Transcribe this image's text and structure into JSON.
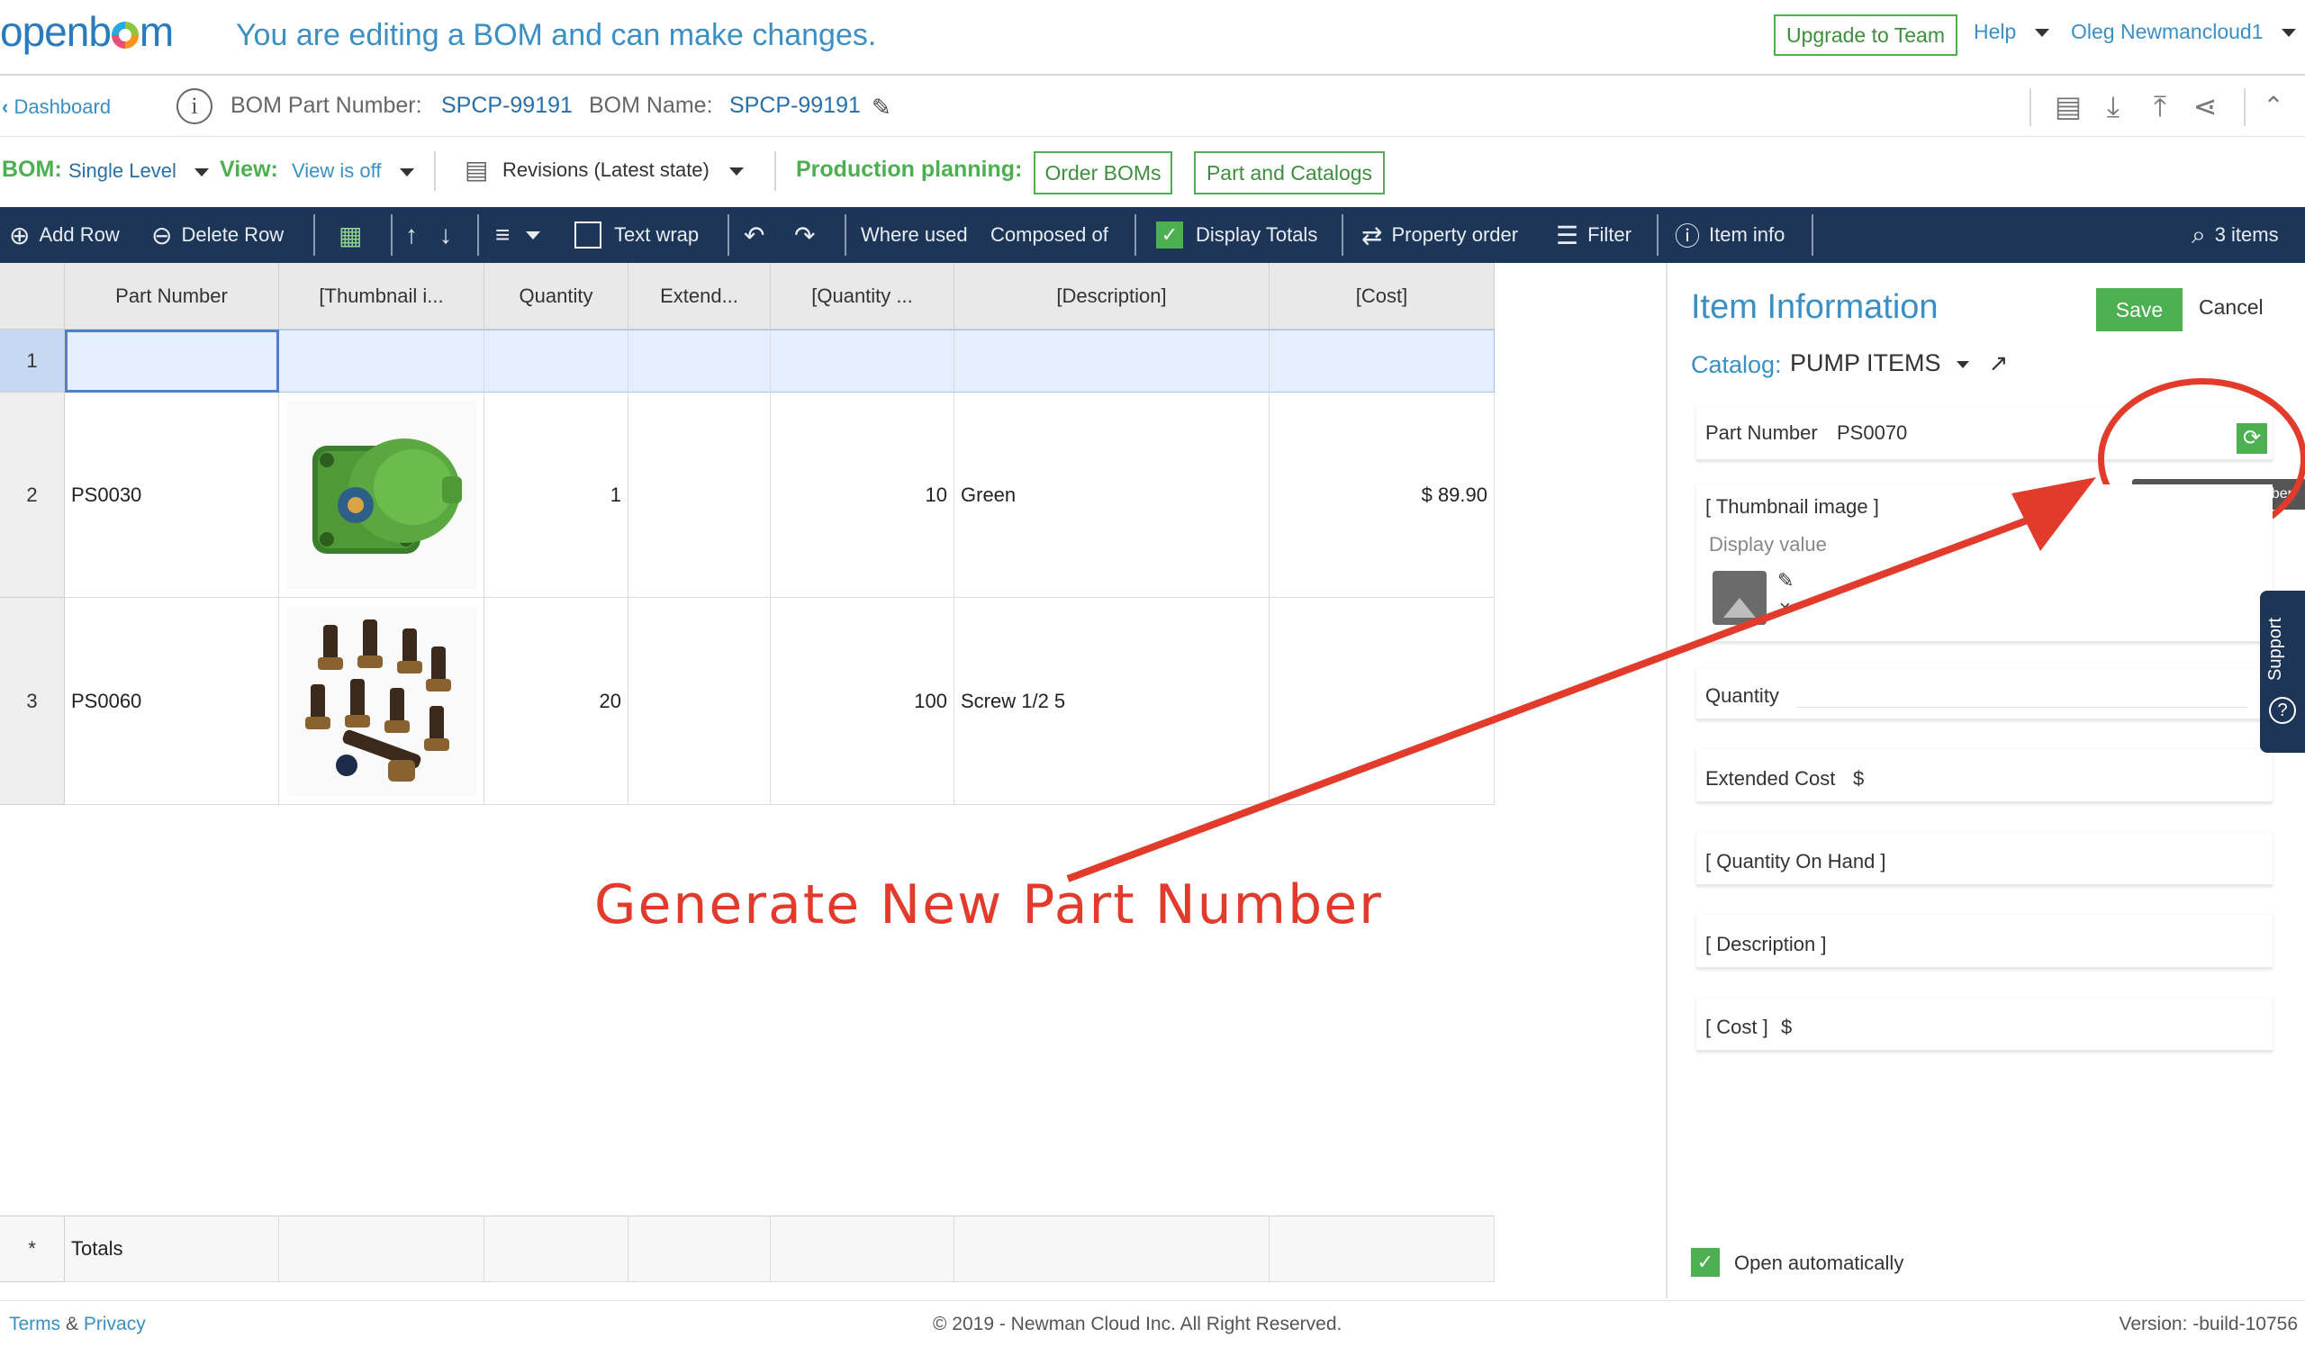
{
  "header": {
    "logo": "openbom",
    "editing_message": "You are editing a BOM and can make changes.",
    "upgrade_button": "Upgrade to Team",
    "help": "Help",
    "user": "Oleg Newmancloud1"
  },
  "infobar": {
    "back": "Dashboard",
    "bom_part_number_label": "BOM Part Number:",
    "bom_part_number": "SPCP-99191",
    "bom_name_label": "BOM Name:",
    "bom_name": "SPCP-99191"
  },
  "bombar": {
    "bom_label": "BOM:",
    "bom_value": "Single Level",
    "view_label": "View:",
    "view_value": "View is off",
    "revisions": "Revisions (Latest state)",
    "production_label": "Production planning:",
    "order_boms": "Order BOMs",
    "part_catalogs": "Part and Catalogs"
  },
  "toolbar": {
    "add_row": "Add Row",
    "delete_row": "Delete Row",
    "text_wrap": "Text wrap",
    "where_used": "Where used",
    "composed_of": "Composed of",
    "display_totals": "Display Totals",
    "property_order": "Property order",
    "filter": "Filter",
    "item_info": "Item info",
    "items_count": "3 items"
  },
  "grid": {
    "columns": [
      "Part Number",
      "[Thumbnail i...",
      "Quantity",
      "Extend...",
      "[Quantity ...",
      "[Description]",
      "[Cost]"
    ],
    "rows": [
      {
        "num": "1",
        "part": "",
        "qty": "",
        "ext": "",
        "qoh": "",
        "desc": "",
        "cost": ""
      },
      {
        "num": "2",
        "part": "PS0030",
        "qty": "1",
        "ext": "",
        "qoh": "10",
        "desc": "Green",
        "cost": "$ 89.90"
      },
      {
        "num": "3",
        "part": "PS0060",
        "qty": "20",
        "ext": "",
        "qoh": "100",
        "desc": "Screw 1/2 5",
        "cost": ""
      }
    ],
    "totals_marker": "*",
    "totals_label": "Totals"
  },
  "panel": {
    "title": "Item Information",
    "save": "Save",
    "cancel": "Cancel",
    "catalog_label": "Catalog:",
    "catalog_value": "PUMP ITEMS",
    "part_number_label": "Part Number",
    "part_number_value": "PS0070",
    "generate_tooltip": "Generate Part Number",
    "thumbnail_label": "[ Thumbnail image ]",
    "display_value_placeholder": "Display value",
    "quantity_label": "Quantity",
    "extended_cost_label": "Extended Cost",
    "currency": "$",
    "qoh_label": "[ Quantity On Hand ]",
    "description_label": "[ Description ]",
    "cost_label": "[ Cost ]",
    "open_automatically": "Open automatically",
    "support": "Support"
  },
  "annotation": {
    "text": "Generate New Part Number",
    "color": "#e33b2b"
  },
  "footer": {
    "terms": "Terms",
    "amp": "&",
    "privacy": "Privacy",
    "copyright": "© 2019 - Newman Cloud Inc. All Right Reserved.",
    "version": "Version: -build-10756"
  },
  "colors": {
    "toolbar_bg": "#1d3557",
    "accent_green": "#4caf50",
    "link_blue": "#3a8fc5"
  }
}
